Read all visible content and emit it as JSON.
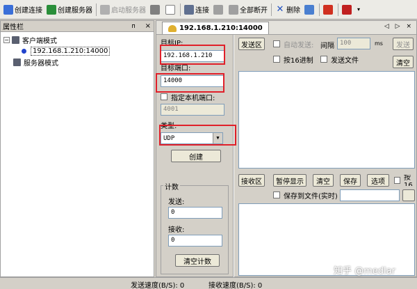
{
  "toolbar": {
    "create_connection": "创建连接",
    "create_server": "创建服务器",
    "start_server": "启动服务器",
    "connect": "连接",
    "disconnect_all": "全部断开",
    "delete": "删除"
  },
  "sidebar": {
    "title": "属性栏",
    "pin": "ᴨ",
    "close": "×",
    "client_mode": "客户端模式",
    "connection": "192.168.1.210:14000",
    "server_mode": "服务器模式"
  },
  "tab": {
    "label": "192.168.1.210:14000",
    "controls": "◁ ▷ ×"
  },
  "config": {
    "target_ip_label": "目标IP:",
    "target_ip": "192.168.1.210",
    "target_port_label": "目标端口:",
    "target_port": "14000",
    "local_port_label": "指定本机端口:",
    "local_port": "4001",
    "type_label": "类型:",
    "type_value": "UDP",
    "create_button": "创建",
    "count_label": "计数",
    "send_label": "发送:",
    "send_count": "0",
    "recv_label": "接收:",
    "recv_count": "0",
    "clear_count_button": "清空计数"
  },
  "send_area": {
    "title": "发送区",
    "auto_send": "自动发送:",
    "interval_label": "间隔",
    "interval_value": "100",
    "interval_unit": "ms",
    "send_button": "发送",
    "hex_label": "按16进制",
    "send_file_label": "发送文件",
    "clear_button": "清空"
  },
  "recv_area": {
    "title": "接收区",
    "pause_button": "暂停显示",
    "clear_button": "清空",
    "save_button": "保存",
    "options_button": "选项",
    "hex_label": "按16",
    "save_to_file_label": "保存到文件(实时)"
  },
  "status": {
    "send_speed": "发送速度(B/S): 0",
    "recv_speed": "接收速度(B/S): 0"
  },
  "watermark": "知乎 @medlar",
  "colors": {
    "highlight_box": "#e0202a",
    "accent": "#2244cc"
  }
}
